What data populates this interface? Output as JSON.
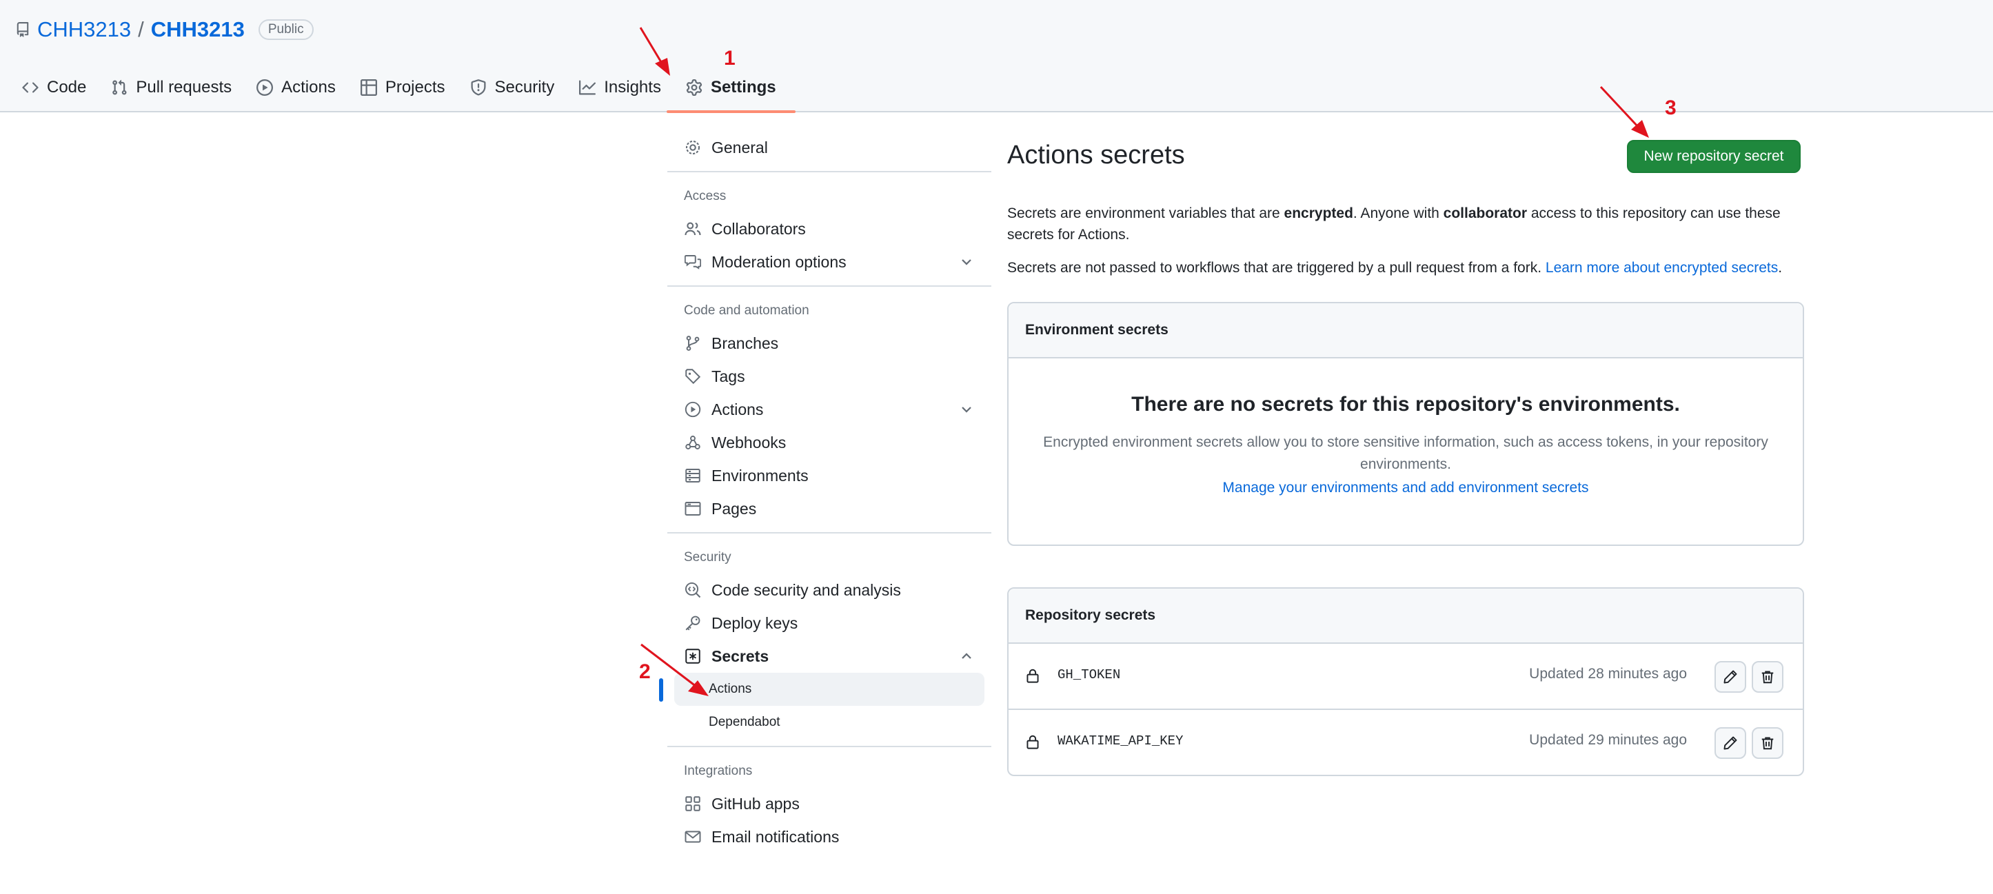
{
  "repo": {
    "owner": "CHH3213",
    "separator": "/",
    "name": "CHH3213",
    "visibility": "Public"
  },
  "tabs": [
    {
      "label": "Code",
      "icon": "code-icon"
    },
    {
      "label": "Pull requests",
      "icon": "git-pull-request-icon"
    },
    {
      "label": "Actions",
      "icon": "play-icon"
    },
    {
      "label": "Projects",
      "icon": "table-icon"
    },
    {
      "label": "Security",
      "icon": "shield-icon"
    },
    {
      "label": "Insights",
      "icon": "graph-icon"
    },
    {
      "label": "Settings",
      "icon": "gear-icon",
      "active": true
    }
  ],
  "sidebar": {
    "general": "General",
    "access": {
      "heading": "Access",
      "items": [
        "Collaborators",
        "Moderation options"
      ]
    },
    "code_automation": {
      "heading": "Code and automation",
      "items": [
        "Branches",
        "Tags",
        "Actions",
        "Webhooks",
        "Environments",
        "Pages"
      ]
    },
    "security": {
      "heading": "Security",
      "items": [
        "Code security and analysis",
        "Deploy keys",
        "Secrets"
      ],
      "secrets_sub": [
        "Actions",
        "Dependabot"
      ]
    },
    "integrations": {
      "heading": "Integrations",
      "items": [
        "GitHub apps",
        "Email notifications"
      ]
    }
  },
  "main": {
    "title": "Actions secrets",
    "new_button": "New repository secret",
    "desc1": {
      "a": "Secrets are environment variables that are ",
      "b": "encrypted",
      "c": ". Anyone with ",
      "d": "collaborator",
      "e": " access to this repository can use these secrets for Actions."
    },
    "desc2": {
      "text": "Secrets are not passed to workflows that are triggered by a pull request from a fork. ",
      "link": "Learn more about encrypted secrets",
      "end": "."
    },
    "env": {
      "header": "Environment secrets",
      "blank_title": "There are no secrets for this repository's environments.",
      "blank_text": "Encrypted environment secrets allow you to store sensitive information, such as access tokens, in your repository environments.",
      "blank_link": "Manage your environments and add environment secrets"
    },
    "repo_secrets": {
      "header": "Repository secrets",
      "rows": [
        {
          "name": "GH_TOKEN",
          "updated": "Updated 28 minutes ago"
        },
        {
          "name": "WAKATIME_API_KEY",
          "updated": "Updated 29 minutes ago"
        }
      ]
    }
  },
  "annotations": {
    "n1": "1",
    "n2": "2",
    "n3": "3",
    "color": "#e0141e"
  }
}
